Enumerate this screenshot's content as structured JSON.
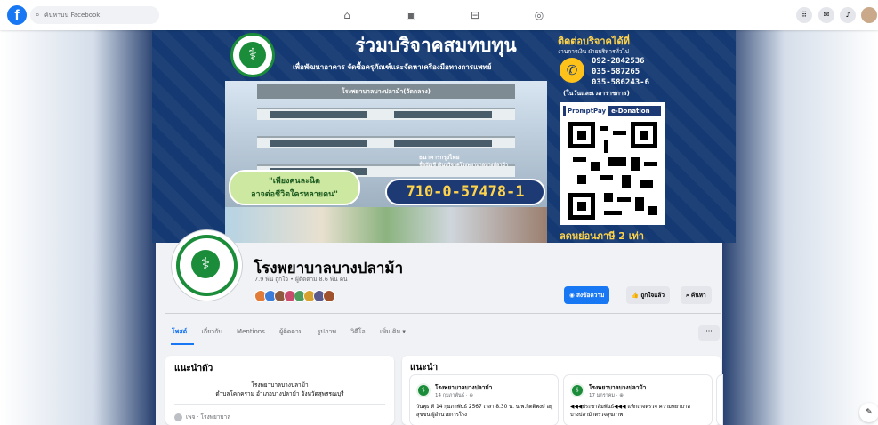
{
  "topbar": {
    "logo": "f",
    "search_placeholder": "ค้นหาบน Facebook",
    "nav_icons": [
      "home-icon",
      "video-icon",
      "marketplace-icon",
      "gaming-icon"
    ],
    "right_icons": [
      "menu-grid-icon",
      "messenger-icon",
      "notifications-icon",
      "profile-avatar"
    ]
  },
  "cover": {
    "title": "ร่วมบริจาคสมทบทุน",
    "subtitle": "เพื่อพัฒนาอาคาร จัดซื้อครุภัณฑ์และจัดหาเครื่องมือทางการแพทย์",
    "building_label": "โรงพยาบาลบางปลาม้า(วัดกลาง)",
    "slogan_line1": "\"เพียงคนละนิด",
    "slogan_line2": "อาจต่อชีวิตใครหลายคน\"",
    "bank_name": "ธนาคารกรุงไทย",
    "bank_account_name": "ชื่อบัญชี เงินบริจาคโรงพยาบาลบางปลาม้า",
    "account_number": "710-0-57478-1",
    "contact_heading": "ติดต่อบริจาคได้ที่",
    "contact_dept": "งานการเงิน ฝ่ายบริหารทั่วไป",
    "phones": [
      "092-2842536",
      "035-587265",
      "035-586243-6"
    ],
    "hours": "(ในวันและเวลาราชการ)",
    "promptpay": "PromptPay",
    "edonation": "e-Donation",
    "tax_note": "ลดหย่อนภาษี 2 เท่า"
  },
  "profile": {
    "name": "โรงพยาบาลบางปลาม้า",
    "stats": "7.9 พัน ถูกใจ • ผู้ติดตาม 8.6 พัน คน",
    "friend_colors": [
      "#e07b39",
      "#3b7dd8",
      "#8f5b3f",
      "#c94b6d",
      "#4f9d5d",
      "#d6a12e",
      "#5a5a8c",
      "#a0522d"
    ]
  },
  "actions": {
    "message": "ส่งข้อความ",
    "liked": "ถูกใจแล้ว",
    "search": "ค้นหา"
  },
  "tabs": [
    "โพสต์",
    "เกี่ยวกับ",
    "Mentions",
    "ผู้ติดตาม",
    "รูปภาพ",
    "วิดีโอ",
    "เพิ่มเติม ▾"
  ],
  "more_button": "···",
  "intro": {
    "title": "แนะนำตัว",
    "line1": "โรงพยาบาลบางปลาม้า",
    "line2": "ตำบลโคกคราม อำเภอบางปลาม้า จังหวัดสุพรรณบุรี",
    "category": "เพจ · โรงพยาบาล"
  },
  "recommend": {
    "title": "แนะนำ",
    "posts": [
      {
        "author": "โรงพยาบาลบางปลาม้า",
        "date": "14 กุมภาพันธ์ · ⊕",
        "text": "วันพุธ ที่ 14 กุมภาพันธ์ 2567 เวลา 8.30 น. น.พ.กิตติพงษ์ อยู่สุขขน ผู้อำนวยการโรง"
      },
      {
        "author": "โรงพยาบาลบางปลาม้า",
        "date": "17 มกราคม · ⊕",
        "text": "◀◀◀ประชาสัมพันธ์◀◀◀ แพ็กเกจตรวจ ความพยาบาลบางปลาม้าตรวจสุขภาพ"
      }
    ]
  },
  "compose_icon": "compose-icon"
}
